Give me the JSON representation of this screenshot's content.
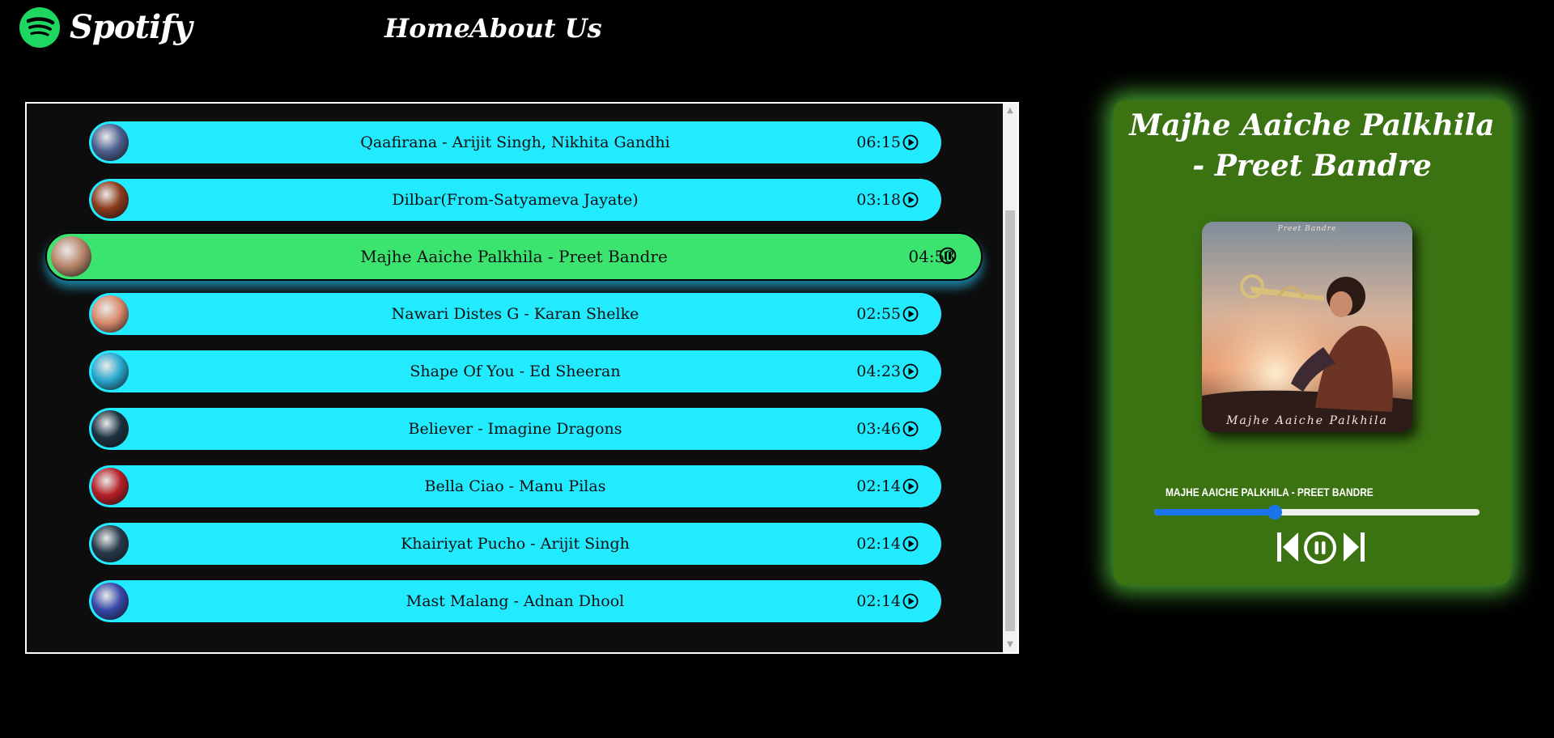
{
  "header": {
    "brand": "Spotify",
    "nav": {
      "home": "Home",
      "about": "About Us"
    }
  },
  "songs": [
    {
      "title": "Qaafirana - Arijit Singh, Nikhita Gandhi",
      "duration": "06:15",
      "state": "play",
      "thumb_color": "#4a5f8e"
    },
    {
      "title": "Dilbar(From-Satyameva Jayate)",
      "duration": "03:18",
      "state": "play",
      "thumb_color": "#8a3a1a"
    },
    {
      "title": "Majhe Aaiche Palkhila - Preet Bandre",
      "duration": "04:53",
      "state": "pause",
      "active": true,
      "thumb_color": "#b8866a"
    },
    {
      "title": "Nawari Distes G - Karan Shelke",
      "duration": "02:55",
      "state": "play",
      "thumb_color": "#d88a6c"
    },
    {
      "title": "Shape Of You - Ed Sheeran",
      "duration": "04:23",
      "state": "play",
      "thumb_color": "#2aa8cf"
    },
    {
      "title": "Believer - Imagine Dragons",
      "duration": "03:46",
      "state": "play",
      "thumb_color": "#1b3140"
    },
    {
      "title": "Bella Ciao - Manu Pilas",
      "duration": "02:14",
      "state": "play",
      "thumb_color": "#b51e26"
    },
    {
      "title": "Khairiyat Pucho - Arijit Singh",
      "duration": "02:14",
      "state": "play",
      "thumb_color": "#26394a"
    },
    {
      "title": "Mast Malang - Adnan Dhool",
      "duration": "02:14",
      "state": "play",
      "thumb_color": "#3647a8"
    }
  ],
  "player": {
    "title": "Majhe Aaiche Palkhila - Preet Bandre",
    "album_caption": "Majhe Aaiche Palkhila",
    "album_artist": "Preet Bandre",
    "now_playing": "MAJHE AAICHE PALKHILA - PREET BANDRE",
    "progress": 0.37
  },
  "colors": {
    "song_bg": "#22eaff",
    "active_bg": "#3be46f",
    "player_bg": "#3b7313",
    "accent": "#1a73e8"
  }
}
